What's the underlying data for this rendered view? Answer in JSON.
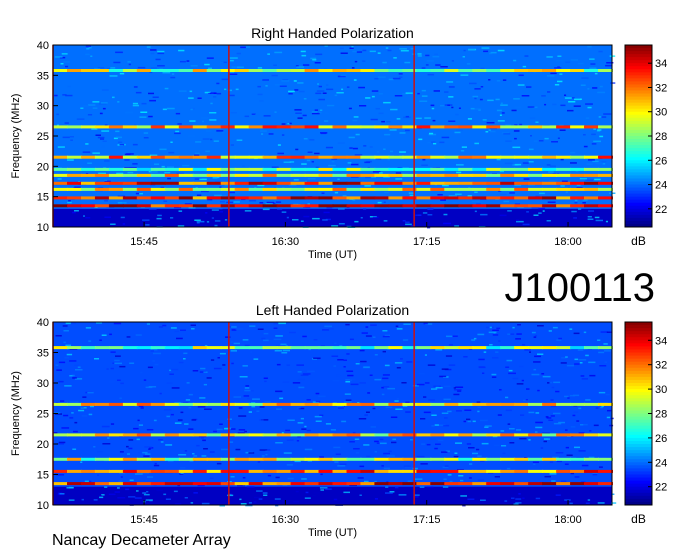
{
  "chart_data": [
    {
      "type": "heatmap",
      "title": "Right Handed Polarization",
      "xlabel": "Time (UT)",
      "ylabel": "Frequency (MHz)",
      "x_ticks": [
        "15:45",
        "16:30",
        "17:15",
        "18:00"
      ],
      "x_tick_minutes": [
        945,
        990,
        1035,
        1080
      ],
      "xlim_minutes": [
        916,
        1094
      ],
      "ylim": [
        10,
        40
      ],
      "y_ticks": [
        10,
        15,
        20,
        25,
        30,
        35,
        40
      ],
      "colorbar": {
        "label": "dB",
        "ticks": [
          22,
          24,
          26,
          28,
          30,
          32,
          34
        ],
        "range": [
          20.5,
          35.5
        ]
      },
      "background_db": 24,
      "bands": [
        {
          "freq": 13.5,
          "db": 34
        },
        {
          "freq": 14.8,
          "db": 33
        },
        {
          "freq": 16.2,
          "db": 30
        },
        {
          "freq": 17.2,
          "db": 33
        },
        {
          "freq": 18.5,
          "db": 30
        },
        {
          "freq": 19.5,
          "db": 28
        },
        {
          "freq": 21.5,
          "db": 31
        },
        {
          "freq": 26.5,
          "db": 31
        },
        {
          "freq": 35.8,
          "db": 29
        }
      ],
      "vertical_markers_minutes": [
        916,
        972,
        1031
      ]
    },
    {
      "type": "heatmap",
      "title": "Left Handed Polarization",
      "xlabel": "Time (UT)",
      "ylabel": "Frequency (MHz)",
      "x_ticks": [
        "15:45",
        "16:30",
        "17:15",
        "18:00"
      ],
      "x_tick_minutes": [
        945,
        990,
        1035,
        1080
      ],
      "xlim_minutes": [
        916,
        1094
      ],
      "ylim": [
        10,
        40
      ],
      "y_ticks": [
        10,
        15,
        20,
        25,
        30,
        35,
        40
      ],
      "colorbar": {
        "label": "dB",
        "ticks": [
          22,
          24,
          26,
          28,
          30,
          32,
          34
        ],
        "range": [
          20.5,
          35.5
        ]
      },
      "background_db": 23.5,
      "bands": [
        {
          "freq": 13.5,
          "db": 33
        },
        {
          "freq": 15.5,
          "db": 32
        },
        {
          "freq": 17.5,
          "db": 29
        },
        {
          "freq": 21.5,
          "db": 30
        },
        {
          "freq": 26.5,
          "db": 30
        },
        {
          "freq": 35.8,
          "db": 28
        }
      ],
      "vertical_markers_minutes": [
        916,
        972,
        1031
      ]
    }
  ],
  "event_id": "J100113",
  "instrument": "Nancay Decameter Array"
}
